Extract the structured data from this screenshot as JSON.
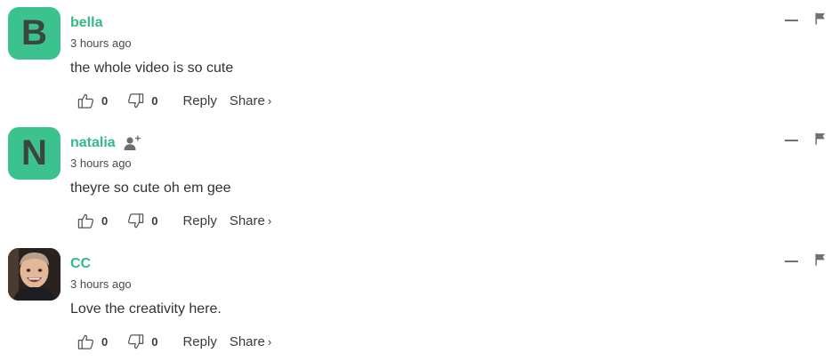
{
  "comments": [
    {
      "avatar_letter": "B",
      "username": "bella",
      "timestamp": "3 hours ago",
      "text": "the whole video is so cute",
      "likes": "0",
      "dislikes": "0",
      "reply_label": "Reply",
      "share_label": "Share",
      "share_chevron": "›"
    },
    {
      "avatar_letter": "N",
      "username": "natalia",
      "timestamp": "3 hours ago",
      "text": "theyre so cute oh em gee",
      "likes": "0",
      "dislikes": "0",
      "reply_label": "Reply",
      "share_label": "Share",
      "share_chevron": "›"
    },
    {
      "avatar_letter": "",
      "username": "CC",
      "timestamp": "3 hours ago",
      "text": "Love the creativity here.",
      "likes": "0",
      "dislikes": "0",
      "reply_label": "Reply",
      "share_label": "Share",
      "share_chevron": "›"
    }
  ],
  "colors": {
    "username": "#35b987",
    "avatar_bg": "#3cc28f",
    "text": "#333333"
  },
  "icons": {
    "like": "thumbs-up-icon",
    "dislike": "thumbs-down-icon",
    "follow": "add-user-icon",
    "collapse": "minus-icon",
    "flag": "flag-icon"
  }
}
